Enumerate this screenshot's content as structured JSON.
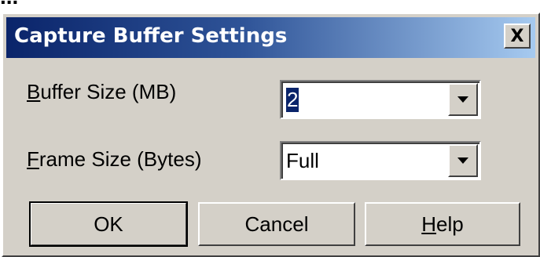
{
  "top_fragment": "...",
  "dialog": {
    "title": "Capture Buffer Settings",
    "close_label": "X"
  },
  "fields": [
    {
      "label_mnemonic": "B",
      "label_rest": "uffer Size (MB)",
      "value": "2"
    },
    {
      "label_mnemonic": "F",
      "label_rest": "rame Size (Bytes)",
      "value": "Full"
    }
  ],
  "buttons": {
    "ok": "OK",
    "cancel": "Cancel",
    "help_mnemonic": "H",
    "help_rest": "elp"
  },
  "colors": {
    "face": "#d4d0c8",
    "title_start": "#0a246a",
    "title_end": "#a6caf0",
    "selection": "#0a246a"
  },
  "icons": {
    "close": "close-icon",
    "dropdown": "chevron-down-icon"
  }
}
